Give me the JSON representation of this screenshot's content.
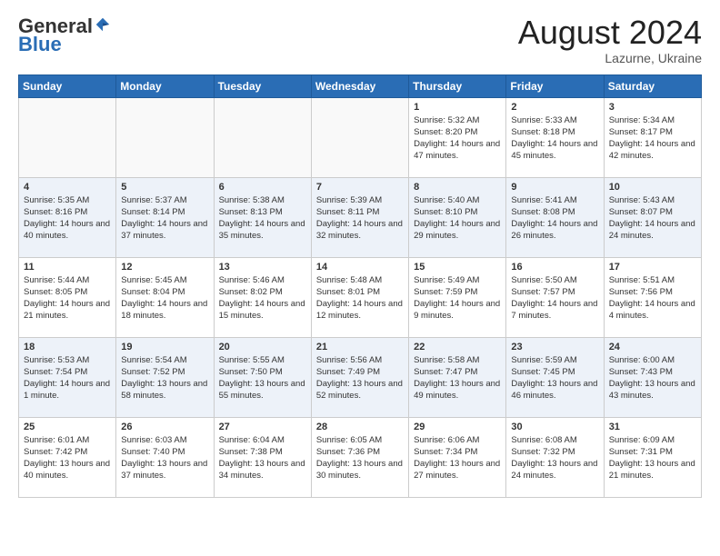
{
  "header": {
    "logo_general": "General",
    "logo_blue": "Blue",
    "month_title": "August 2024",
    "location": "Lazurne, Ukraine"
  },
  "weekdays": [
    "Sunday",
    "Monday",
    "Tuesday",
    "Wednesday",
    "Thursday",
    "Friday",
    "Saturday"
  ],
  "weeks": [
    [
      {
        "day": "",
        "empty": true
      },
      {
        "day": "",
        "empty": true
      },
      {
        "day": "",
        "empty": true
      },
      {
        "day": "",
        "empty": true
      },
      {
        "day": "1",
        "sunrise": "5:32 AM",
        "sunset": "8:20 PM",
        "daylight": "14 hours and 47 minutes."
      },
      {
        "day": "2",
        "sunrise": "5:33 AM",
        "sunset": "8:18 PM",
        "daylight": "14 hours and 45 minutes."
      },
      {
        "day": "3",
        "sunrise": "5:34 AM",
        "sunset": "8:17 PM",
        "daylight": "14 hours and 42 minutes."
      }
    ],
    [
      {
        "day": "4",
        "sunrise": "5:35 AM",
        "sunset": "8:16 PM",
        "daylight": "14 hours and 40 minutes."
      },
      {
        "day": "5",
        "sunrise": "5:37 AM",
        "sunset": "8:14 PM",
        "daylight": "14 hours and 37 minutes."
      },
      {
        "day": "6",
        "sunrise": "5:38 AM",
        "sunset": "8:13 PM",
        "daylight": "14 hours and 35 minutes."
      },
      {
        "day": "7",
        "sunrise": "5:39 AM",
        "sunset": "8:11 PM",
        "daylight": "14 hours and 32 minutes."
      },
      {
        "day": "8",
        "sunrise": "5:40 AM",
        "sunset": "8:10 PM",
        "daylight": "14 hours and 29 minutes."
      },
      {
        "day": "9",
        "sunrise": "5:41 AM",
        "sunset": "8:08 PM",
        "daylight": "14 hours and 26 minutes."
      },
      {
        "day": "10",
        "sunrise": "5:43 AM",
        "sunset": "8:07 PM",
        "daylight": "14 hours and 24 minutes."
      }
    ],
    [
      {
        "day": "11",
        "sunrise": "5:44 AM",
        "sunset": "8:05 PM",
        "daylight": "14 hours and 21 minutes."
      },
      {
        "day": "12",
        "sunrise": "5:45 AM",
        "sunset": "8:04 PM",
        "daylight": "14 hours and 18 minutes."
      },
      {
        "day": "13",
        "sunrise": "5:46 AM",
        "sunset": "8:02 PM",
        "daylight": "14 hours and 15 minutes."
      },
      {
        "day": "14",
        "sunrise": "5:48 AM",
        "sunset": "8:01 PM",
        "daylight": "14 hours and 12 minutes."
      },
      {
        "day": "15",
        "sunrise": "5:49 AM",
        "sunset": "7:59 PM",
        "daylight": "14 hours and 9 minutes."
      },
      {
        "day": "16",
        "sunrise": "5:50 AM",
        "sunset": "7:57 PM",
        "daylight": "14 hours and 7 minutes."
      },
      {
        "day": "17",
        "sunrise": "5:51 AM",
        "sunset": "7:56 PM",
        "daylight": "14 hours and 4 minutes."
      }
    ],
    [
      {
        "day": "18",
        "sunrise": "5:53 AM",
        "sunset": "7:54 PM",
        "daylight": "14 hours and 1 minute."
      },
      {
        "day": "19",
        "sunrise": "5:54 AM",
        "sunset": "7:52 PM",
        "daylight": "13 hours and 58 minutes."
      },
      {
        "day": "20",
        "sunrise": "5:55 AM",
        "sunset": "7:50 PM",
        "daylight": "13 hours and 55 minutes."
      },
      {
        "day": "21",
        "sunrise": "5:56 AM",
        "sunset": "7:49 PM",
        "daylight": "13 hours and 52 minutes."
      },
      {
        "day": "22",
        "sunrise": "5:58 AM",
        "sunset": "7:47 PM",
        "daylight": "13 hours and 49 minutes."
      },
      {
        "day": "23",
        "sunrise": "5:59 AM",
        "sunset": "7:45 PM",
        "daylight": "13 hours and 46 minutes."
      },
      {
        "day": "24",
        "sunrise": "6:00 AM",
        "sunset": "7:43 PM",
        "daylight": "13 hours and 43 minutes."
      }
    ],
    [
      {
        "day": "25",
        "sunrise": "6:01 AM",
        "sunset": "7:42 PM",
        "daylight": "13 hours and 40 minutes."
      },
      {
        "day": "26",
        "sunrise": "6:03 AM",
        "sunset": "7:40 PM",
        "daylight": "13 hours and 37 minutes."
      },
      {
        "day": "27",
        "sunrise": "6:04 AM",
        "sunset": "7:38 PM",
        "daylight": "13 hours and 34 minutes."
      },
      {
        "day": "28",
        "sunrise": "6:05 AM",
        "sunset": "7:36 PM",
        "daylight": "13 hours and 30 minutes."
      },
      {
        "day": "29",
        "sunrise": "6:06 AM",
        "sunset": "7:34 PM",
        "daylight": "13 hours and 27 minutes."
      },
      {
        "day": "30",
        "sunrise": "6:08 AM",
        "sunset": "7:32 PM",
        "daylight": "13 hours and 24 minutes."
      },
      {
        "day": "31",
        "sunrise": "6:09 AM",
        "sunset": "7:31 PM",
        "daylight": "13 hours and 21 minutes."
      }
    ]
  ]
}
